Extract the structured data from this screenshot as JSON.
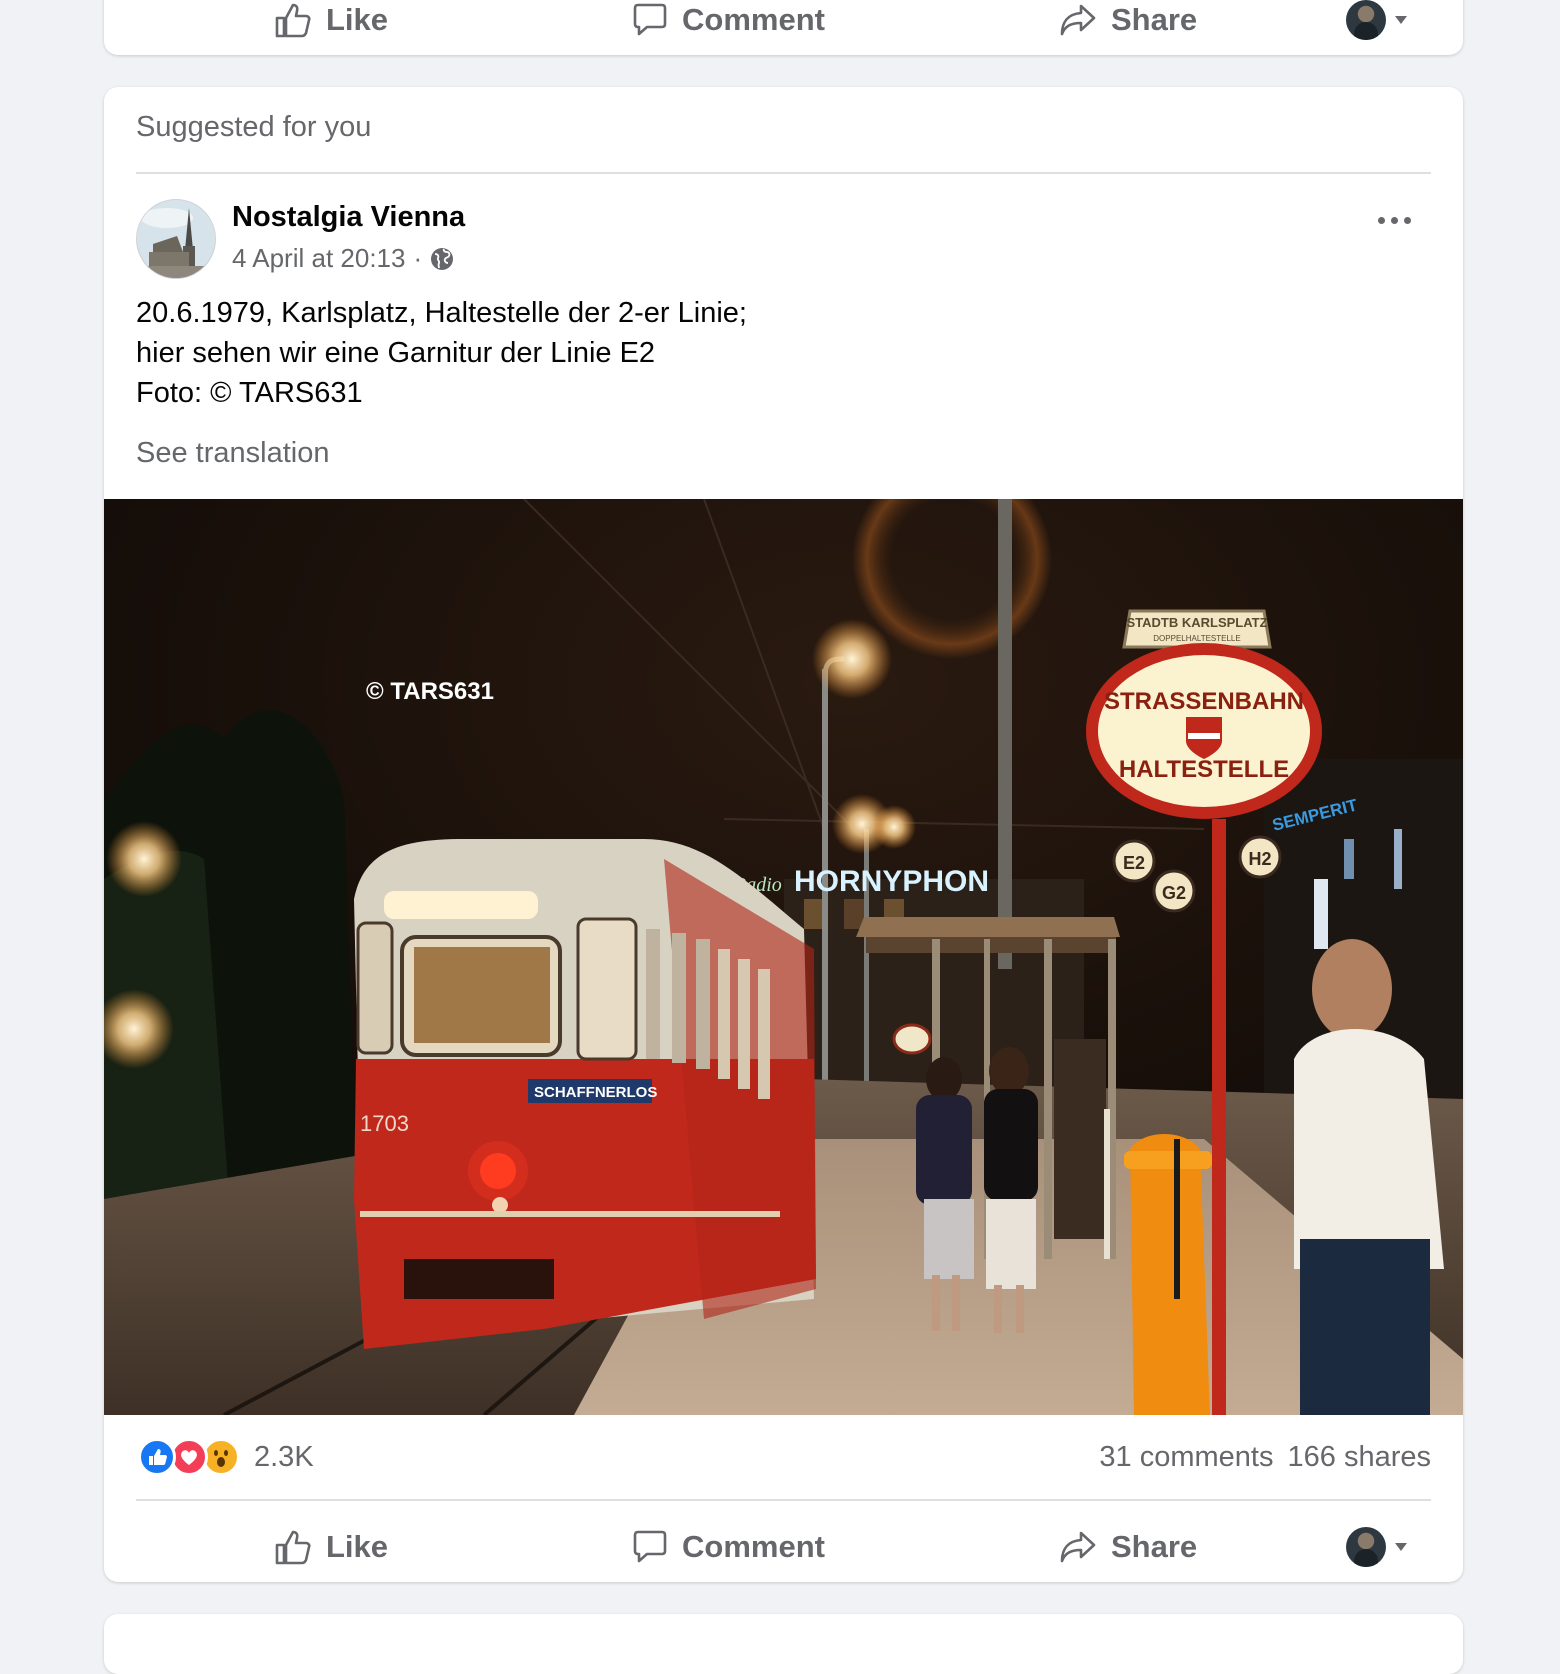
{
  "top_card": {
    "actions": {
      "like": "Like",
      "comment": "Comment",
      "share": "Share"
    }
  },
  "post": {
    "section_label": "Suggested for you",
    "page_name": "Nostalgia Vienna",
    "timestamp": "4 April at 20:13",
    "separator": "·",
    "audience_icon": "globe-icon",
    "text_lines": [
      "20.6.1979, Karlsplatz, Haltestelle der 2-er Linie;",
      "hier sehen wir eine Garnitur der Linie E2",
      "Foto: © TARS631"
    ],
    "see_translation": "See translation",
    "photo": {
      "watermark": "© TARS631",
      "sign_top": "STADTB KARLSPLATZ",
      "sign_top_sub": "DOPPELHALTESTELLE",
      "sign_upper": "STRASSENBAHN",
      "sign_lower": "HALTESTELLE",
      "route_badges": [
        "E2",
        "G2",
        "H2"
      ],
      "neon_sign": "HORNYPHON",
      "neon_prefix": "Radio",
      "tram_number": "1703",
      "tram_label": "SCHAFFNERLOS",
      "shop_sign": "SEMPERIT"
    },
    "reactions": {
      "icons": [
        "like-reaction-icon",
        "love-reaction-icon",
        "wow-reaction-icon"
      ],
      "count": "2.3K"
    },
    "comments_count": "31 comments",
    "shares_count": "166 shares",
    "actions": {
      "like": "Like",
      "comment": "Comment",
      "share": "Share"
    }
  },
  "colors": {
    "page_bg": "#f0f2f5",
    "card_bg": "#ffffff",
    "secondary_text": "#65676b",
    "like_blue": "#1877f2",
    "love_red": "#f33e58",
    "wow_yellow": "#f7b125",
    "tram_red": "#c0281c"
  }
}
